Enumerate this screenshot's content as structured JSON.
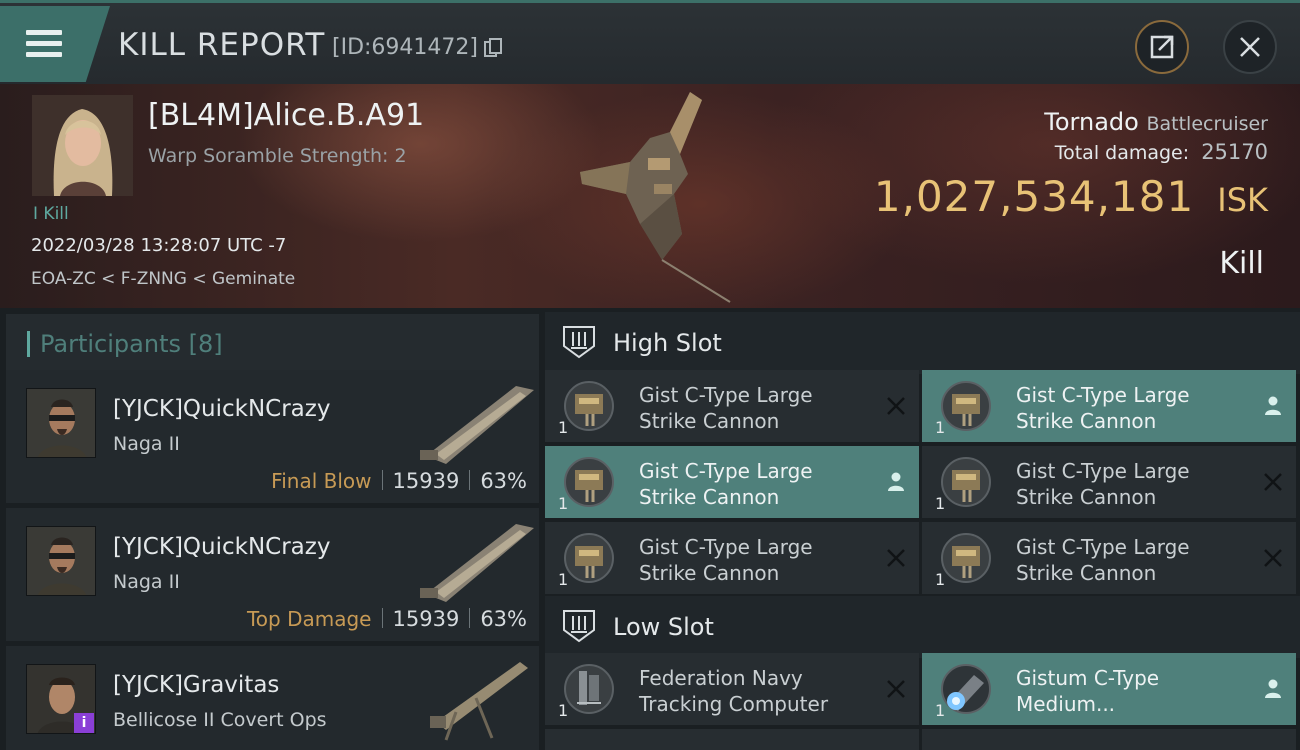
{
  "header": {
    "title": "KILL REPORT",
    "report_id": "[ID:6941472]"
  },
  "victim": {
    "name": "[BL4M]Alice.B.A91",
    "warp_scramble": "Warp Soramble Strength: 2",
    "kill_tag": "I Kill",
    "timestamp": "2022/03/28 13:28:07 UTC -7",
    "location": "EOA-ZC < F-ZNNG < Geminate",
    "ship_name": "Tornado",
    "ship_class": "Battlecruiser",
    "total_damage_label": "Total damage:",
    "total_damage": "25170",
    "isk_value": "1,027,534,181",
    "isk_unit": "ISK",
    "result": "Kill"
  },
  "participants": {
    "label": "Participants",
    "count": "[8]",
    "items": [
      {
        "name": "[YJCK]QuickNCrazy",
        "ship": "Naga II",
        "role": "Final Blow",
        "damage": "15939",
        "percent": "63%"
      },
      {
        "name": "[YJCK]QuickNCrazy",
        "ship": "Naga II",
        "role": "Top Damage",
        "damage": "15939",
        "percent": "63%"
      },
      {
        "name": "[YJCK]Gravitas",
        "ship": "Bellicose II Covert Ops",
        "badge": "i"
      }
    ]
  },
  "high_slot": {
    "label": "High Slot",
    "modules": [
      {
        "line1": "Gist C-Type Large",
        "line2": "Strike Cannon",
        "qty": "1",
        "status": "destroyed"
      },
      {
        "line1": "Gist C-Type Large",
        "line2": "Strike Cannon",
        "qty": "1",
        "status": "dropped"
      },
      {
        "line1": "Gist C-Type Large",
        "line2": "Strike Cannon",
        "qty": "1",
        "status": "dropped"
      },
      {
        "line1": "Gist C-Type Large",
        "line2": "Strike Cannon",
        "qty": "1",
        "status": "destroyed"
      },
      {
        "line1": "Gist C-Type Large",
        "line2": "Strike Cannon",
        "qty": "1",
        "status": "destroyed"
      },
      {
        "line1": "Gist C-Type Large",
        "line2": "Strike Cannon",
        "qty": "1",
        "status": "destroyed"
      }
    ]
  },
  "low_slot": {
    "label": "Low Slot",
    "modules": [
      {
        "line1": "Federation Navy",
        "line2": "Tracking Computer",
        "qty": "1",
        "status": "destroyed"
      },
      {
        "line1": "Gistum C-Type",
        "line2": "Medium...",
        "qty": "1",
        "status": "dropped"
      }
    ]
  },
  "colors": {
    "accent_teal": "#4f807b",
    "isk_gold": "#e8c276",
    "role_gold": "#c79a55"
  }
}
